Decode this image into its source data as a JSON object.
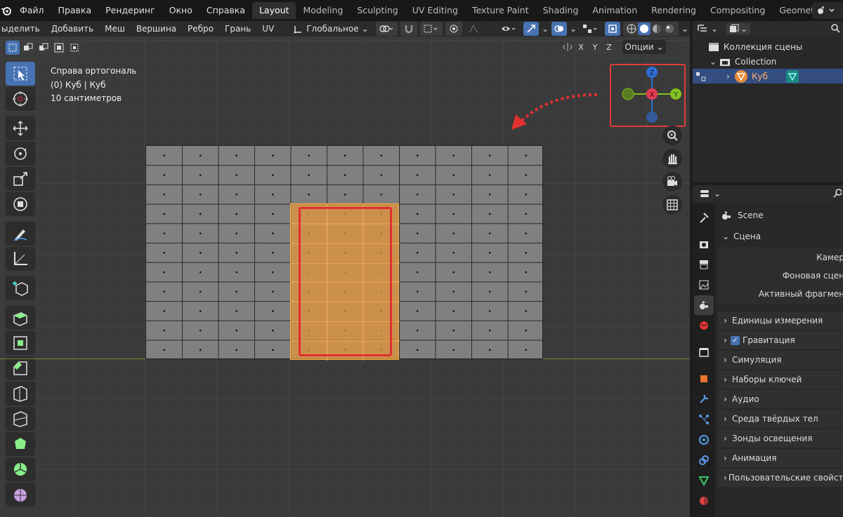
{
  "menu": [
    "Файл",
    "Правка",
    "Рендеринг",
    "Окно",
    "Справка"
  ],
  "workspaces": [
    {
      "label": "Layout",
      "active": true
    },
    {
      "label": "Modeling"
    },
    {
      "label": "Sculpting"
    },
    {
      "label": "UV Editing"
    },
    {
      "label": "Texture Paint"
    },
    {
      "label": "Shading"
    },
    {
      "label": "Animation"
    },
    {
      "label": "Rendering"
    },
    {
      "label": "Compositing"
    },
    {
      "label": "Geometry Nodes"
    }
  ],
  "viewport_header": {
    "menus": [
      "ыделить",
      "Добавить",
      "Меш",
      "Вершина",
      "Ребро",
      "Грань",
      "UV"
    ],
    "transform_orientation": "Глобальное",
    "axis": [
      "X",
      "Y",
      "Z"
    ],
    "options": "Опции"
  },
  "viewport_info": {
    "view_name": "Справа ортогональ",
    "object": "(0) Куб | Куб",
    "scale": "10 сантиметров"
  },
  "gizmo": {
    "axes": [
      {
        "label": "Z",
        "color": "#2e6fd6"
      },
      {
        "label": "X",
        "color": "#e43b56"
      },
      {
        "label": "Y",
        "color": "#84c11d"
      }
    ]
  },
  "outliner": {
    "scene_collection": "Коллекция сцены",
    "collection": "Collection",
    "object": "Куб"
  },
  "properties": {
    "scene_title": "Scene",
    "main_panel": "Сцена",
    "fields": [
      "Камер",
      "Фоновая сцен",
      "Активный фрагмен"
    ],
    "panels": [
      "Единицы измерения",
      "Гравитация",
      "Симуляция",
      "Наборы ключей",
      "Аудио",
      "Среда твёрдых тел",
      "Зонды освещения",
      "Анимация",
      "Пользовательские свойств"
    ]
  },
  "colors": {
    "accent": "#4772b3",
    "selection_face": "#e6963c",
    "highlight_red": "#e03030"
  }
}
